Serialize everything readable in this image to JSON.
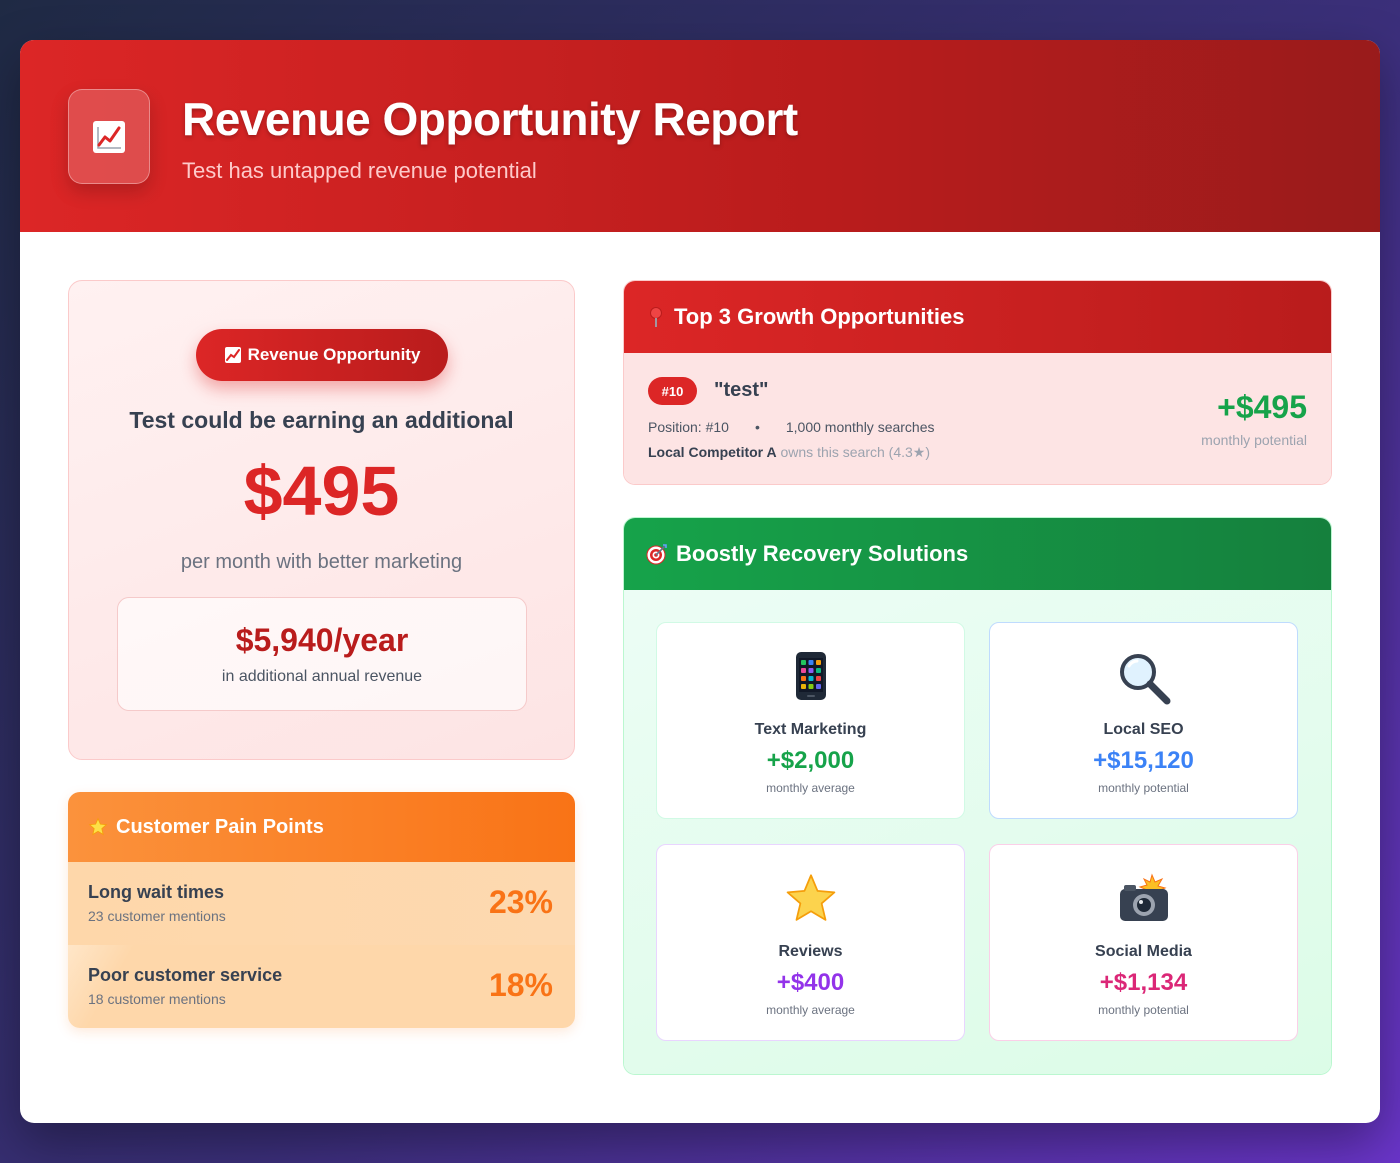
{
  "header": {
    "title": "Revenue Opportunity Report",
    "subtitle": "Test has untapped revenue potential",
    "icon": "chart-increasing-icon"
  },
  "hero": {
    "badge": "Revenue Opportunity",
    "lead": "Test could be earning an additional",
    "amount": "$495",
    "tail": "per month with better marketing",
    "year_amount": "$5,940/year",
    "year_caption": "in additional annual revenue"
  },
  "pain": {
    "title": "Customer Pain Points",
    "items": [
      {
        "label": "Long wait times",
        "sub": "23 customer mentions",
        "pct": "23%"
      },
      {
        "label": "Poor customer service",
        "sub": "18 customer mentions",
        "pct": "18%"
      }
    ]
  },
  "opportunities": {
    "title": "Top 3 Growth Opportunities",
    "items": [
      {
        "rank": "#10",
        "keyword": "\"test\"",
        "position": "Position: #10",
        "dot": "•",
        "searches": "1,000 monthly searches",
        "competitor": "Local Competitor A",
        "owns": " owns this search (4.3★)",
        "value": "+$495",
        "caption": "monthly potential"
      }
    ]
  },
  "solutions": {
    "title": "Boostly Recovery Solutions",
    "items": [
      {
        "name": "Text Marketing",
        "value": "+$2,000",
        "caption": "monthly average",
        "color": "#16a34a",
        "icon": "mobile-phone-icon"
      },
      {
        "name": "Local SEO",
        "value": "+$15,120",
        "caption": "monthly potential",
        "color": "#3b82f6",
        "icon": "magnifier-icon"
      },
      {
        "name": "Reviews",
        "value": "+$400",
        "caption": "monthly average",
        "color": "#9333ea",
        "icon": "star-icon"
      },
      {
        "name": "Social Media",
        "value": "+$1,134",
        "caption": "monthly potential",
        "color": "#db2777",
        "icon": "camera-flash-icon"
      }
    ]
  },
  "colors": {
    "primary_red": "#dc2626",
    "success_green": "#16a34a",
    "accent_orange": "#f97316"
  }
}
